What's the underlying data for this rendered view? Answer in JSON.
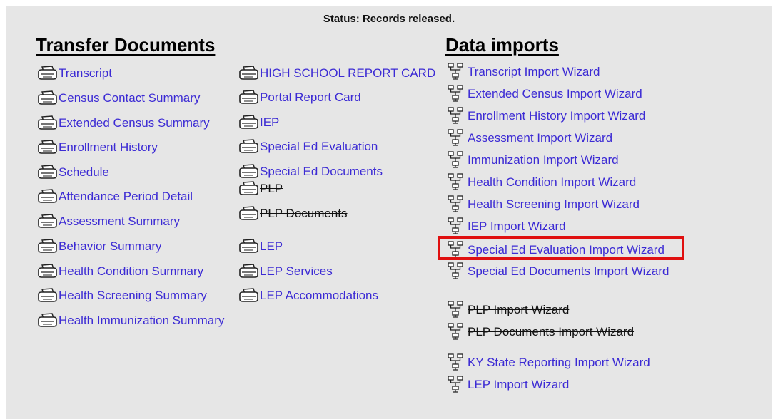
{
  "status": "Status: Records released.",
  "transfer_heading": "Transfer Documents",
  "imports_heading": "Data imports",
  "transfer_col1": [
    {
      "label": "Transcript",
      "struck": false
    },
    {
      "label": "Census Contact Summary",
      "struck": false
    },
    {
      "label": "Extended Census Summary",
      "struck": false
    },
    {
      "label": "Enrollment History",
      "struck": false
    },
    {
      "label": "Schedule",
      "struck": false
    },
    {
      "label": "Attendance Period Detail",
      "struck": false
    },
    {
      "label": "Assessment Summary",
      "struck": false
    },
    {
      "label": "Behavior Summary",
      "struck": false
    },
    {
      "label": "Health Condition Summary",
      "struck": false
    },
    {
      "label": "Health Screening Summary",
      "struck": false
    },
    {
      "label": "Health Immunization Summary",
      "struck": false
    }
  ],
  "transfer_col2": [
    {
      "label": "HIGH SCHOOL REPORT CARD",
      "struck": false
    },
    {
      "label": "Portal Report Card",
      "struck": false
    },
    {
      "label": "IEP",
      "struck": false
    },
    {
      "label": "Special Ed Evaluation",
      "struck": false
    },
    {
      "label": "Special Ed Documents",
      "struck": false
    },
    {
      "label": "PLP",
      "struck": true
    },
    {
      "label": "PLP Documents",
      "struck": true
    },
    {
      "label": "LEP",
      "struck": false
    },
    {
      "label": "LEP Services",
      "struck": false
    },
    {
      "label": "LEP Accommodations",
      "struck": false
    }
  ],
  "imports": [
    {
      "label": "Transcript Import Wizard",
      "struck": false
    },
    {
      "label": "Extended Census Import Wizard",
      "struck": false
    },
    {
      "label": "Enrollment History Import Wizard",
      "struck": false
    },
    {
      "label": "Assessment Import Wizard",
      "struck": false
    },
    {
      "label": "Immunization Import Wizard",
      "struck": false
    },
    {
      "label": "Health Condition Import Wizard",
      "struck": false
    },
    {
      "label": "Health Screening Import Wizard",
      "struck": false
    },
    {
      "label": "IEP Import Wizard",
      "struck": false
    },
    {
      "label": "Special Ed Evaluation Import Wizard",
      "struck": false
    },
    {
      "label": "Special Ed Documents Import Wizard",
      "struck": false
    },
    {
      "label": "PLP Import Wizard",
      "struck": true
    },
    {
      "label": "PLP Documents Import Wizard",
      "struck": true
    },
    {
      "label": "KY State Reporting Import Wizard",
      "struck": false
    },
    {
      "label": "LEP Import Wizard",
      "struck": false
    }
  ],
  "colors": {
    "link": "#3c2bd4",
    "highlight": "#e01010",
    "panel": "#e6e6e6"
  }
}
